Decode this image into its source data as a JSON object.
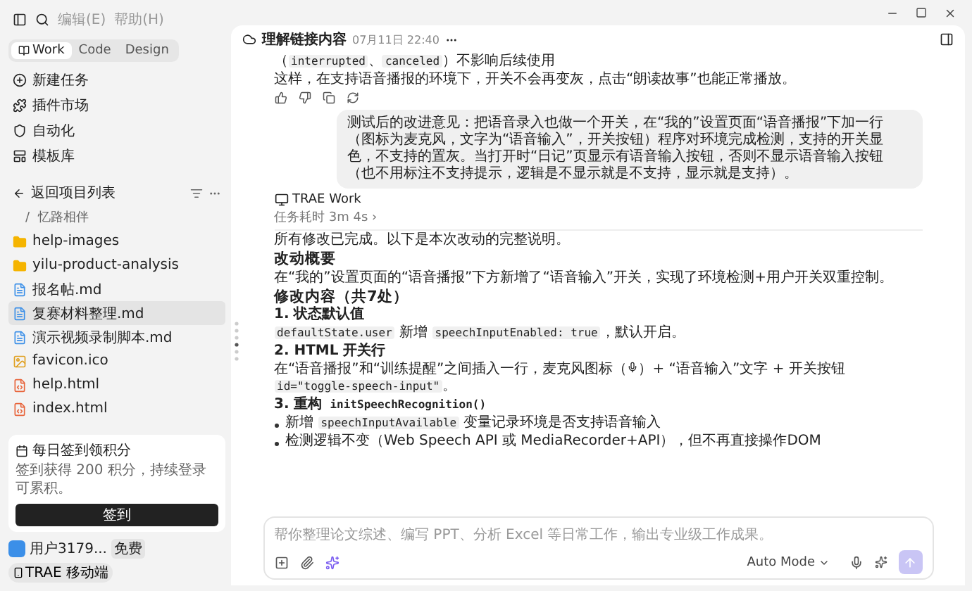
{
  "menu": [
    "编辑(E)",
    "帮助(H)"
  ],
  "mode_tabs": [
    {
      "label": "Work",
      "selected": true
    },
    {
      "label": "Code",
      "selected": false
    },
    {
      "label": "Design",
      "selected": false
    }
  ],
  "nav": [
    {
      "label": "新建任务",
      "kind": "new"
    },
    {
      "label": "插件市场",
      "kind": "plugin"
    },
    {
      "label": "自动化",
      "kind": "auto"
    },
    {
      "label": "模板库",
      "kind": "template"
    }
  ],
  "project": {
    "back_label": "返回项目列表",
    "breadcrumb": [
      "/",
      "忆路相伴"
    ],
    "files": [
      {
        "name": "help-images",
        "kind": "folder",
        "selected": false
      },
      {
        "name": "yilu-product-analysis",
        "kind": "folder",
        "selected": false
      },
      {
        "name": "报名帖.md",
        "kind": "md",
        "selected": false
      },
      {
        "name": "复赛材料整理.md",
        "kind": "md",
        "selected": true
      },
      {
        "name": "演示视频录制脚本.md",
        "kind": "md",
        "selected": false
      },
      {
        "name": "favicon.ico",
        "kind": "image",
        "selected": false
      },
      {
        "name": "help.html",
        "kind": "html",
        "selected": false
      },
      {
        "name": "index.html",
        "kind": "html",
        "selected": false
      }
    ]
  },
  "promo": {
    "title": "每日签到领积分",
    "text": "签到获得 200 积分，持续登录可累积。",
    "button": "签到"
  },
  "user": {
    "name": "用户3179...",
    "plan": "免费",
    "mobile_button": "TRAE 移动端"
  },
  "header": {
    "title": "理解链接内容",
    "time": "07月11日 22:40"
  },
  "messages": [
    {
      "kind": "text",
      "segments": [
        {
          "kind": "text",
          "text": "（"
        },
        {
          "kind": "code",
          "text": "interrupted"
        },
        {
          "kind": "text",
          "text": "、"
        },
        {
          "kind": "code",
          "text": "canceled"
        },
        {
          "kind": "text",
          "text": "）不影响后续使用"
        }
      ]
    },
    {
      "kind": "text",
      "segments": [
        {
          "kind": "text",
          "text": "这样，在支持语音播报的环境下，开关不会再变灰，点击“朗读故事”也能正常播放。"
        }
      ]
    },
    {
      "kind": "actions"
    },
    {
      "kind": "user",
      "text": "测试后的改进意见：把语音录入也做一个开关，在“我的”设置页面“语音播报”下加一行（图标为麦克风，文字为“语音输入”，开关按钮）程序对环境完成检测，支持的开关显色，不支持的置灰。当打开时“日记”页显示有语音输入按钮，否则不显示语音输入按钮（也不用标注不支持提示，逻辑是不显示就是不支持，显示就是支持）。"
    },
    {
      "kind": "agent",
      "name": "TRAE Work",
      "duration": "任务耗时 3m 4s ›"
    },
    {
      "kind": "text",
      "segments": [
        {
          "kind": "text",
          "text": "所有修改已完成。以下是本次改动的完整说明。"
        }
      ]
    },
    {
      "kind": "h2",
      "segments": [
        {
          "kind": "text",
          "text": "改动概要"
        }
      ]
    },
    {
      "kind": "text",
      "segments": [
        {
          "kind": "text",
          "text": "在“我的”设置页面的“语音播报”下方新增了“语音输入”开关，实现了环境检测+用户开关双重控制。"
        }
      ]
    },
    {
      "kind": "h2",
      "segments": [
        {
          "kind": "text",
          "text": "修改内容（共7处）"
        }
      ]
    },
    {
      "kind": "h3",
      "segments": [
        {
          "kind": "text",
          "text": "1. 状态默认值"
        }
      ]
    },
    {
      "kind": "text",
      "segments": [
        {
          "kind": "code",
          "text": "defaultState.user"
        },
        {
          "kind": "text",
          "text": " 新增 "
        },
        {
          "kind": "code",
          "text": "speechInputEnabled: true"
        },
        {
          "kind": "text",
          "text": "，默认开启。"
        }
      ]
    },
    {
      "kind": "h3",
      "segments": [
        {
          "kind": "text",
          "text": "2. HTML 开关行"
        }
      ]
    },
    {
      "kind": "text",
      "segments": [
        {
          "kind": "text",
          "text": "在“语音播报”和“训练提醒”之间插入一行，麦克风图标（"
        },
        {
          "kind": "icon"
        },
        {
          "kind": "text",
          "text": "）+ “语音输入”文字 + 开关按钮 "
        },
        {
          "kind": "code",
          "text": "id=\"toggle-speech-input\""
        },
        {
          "kind": "text",
          "text": "。"
        }
      ]
    },
    {
      "kind": "h3",
      "segments": [
        {
          "kind": "text",
          "text": "3. 重构 "
        },
        {
          "kind": "code",
          "text": "initSpeechRecognition()"
        }
      ]
    },
    {
      "kind": "bullet",
      "segments": [
        {
          "kind": "text",
          "text": "新增 "
        },
        {
          "kind": "code",
          "text": "speechInputAvailable"
        },
        {
          "kind": "text",
          "text": " 变量记录环境是否支持语音输入"
        }
      ]
    },
    {
      "kind": "bullet",
      "segments": [
        {
          "kind": "text",
          "text": "检测逻辑不变（Web Speech API 或 MediaRecorder+API），但不再直接操作DOM"
        }
      ]
    }
  ],
  "composer": {
    "placeholder": "帮你整理论文综述、编写 PPT、分析 Excel 等日常工作，输出专业级工作成果。",
    "mode": "Auto Mode"
  }
}
